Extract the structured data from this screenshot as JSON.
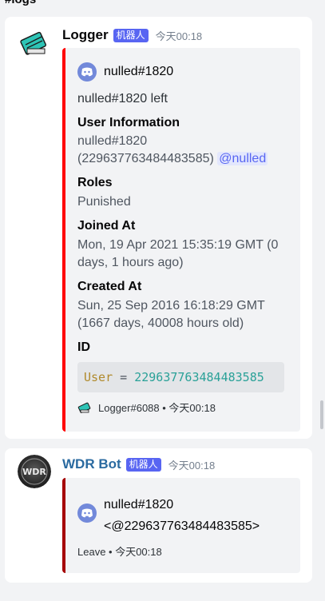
{
  "channel": {
    "name": "#logs"
  },
  "messages": [
    {
      "author": "Logger",
      "bot_tag": "机器人",
      "time": "今天00:18",
      "avatar_icon": "notepad-icon",
      "embed": {
        "color": "#ff0000",
        "author_name": "nulled#1820",
        "description": "nulled#1820 left",
        "fields": [
          {
            "name": "User Information",
            "value_line1": "nulled#1820",
            "value_line2": "(229637763484483585)",
            "mention": "@nulled"
          },
          {
            "name": "Roles",
            "value": "Punished"
          },
          {
            "name": "Joined At",
            "value_line1": "Mon, 19 Apr 2021 15:35:19 GMT (0",
            "value_line2": "days, 1 hours ago)"
          },
          {
            "name": "Created At",
            "value_line1": "Sun, 25 Sep 2016 16:18:29 GMT",
            "value_line2": "(1667 days, 40008 hours old)"
          },
          {
            "name": "ID",
            "code_key": "User",
            "code_op": "=",
            "code_value": "229637763484483585"
          }
        ],
        "footer": "Logger#6088 • 今天00:18"
      }
    },
    {
      "author": "WDR Bot",
      "bot_tag": "机器人",
      "time": "今天00:18",
      "avatar_icon": "wdr-logo-icon",
      "avatar_text": "WDR",
      "embed": {
        "color": "#a50000",
        "author_name": "nulled#1820",
        "author_line2": "<@229637763484483585>",
        "footer": "Leave • 今天00:18"
      }
    }
  ]
}
